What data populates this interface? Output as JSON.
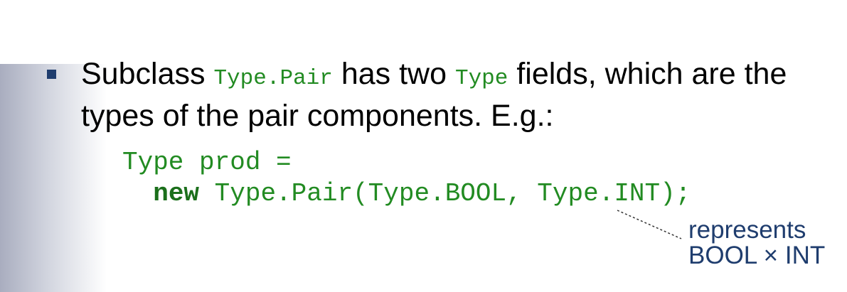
{
  "slide": {
    "bullet": {
      "part1": "Subclass ",
      "code1": "Type.Pair",
      "part2": " has two ",
      "code2": "Type",
      "part3": " fields, which are the types of the pair components. E.g.:"
    },
    "code": {
      "line1": "Type prod =",
      "keyword": "new",
      "line2_rest": " Type.Pair(Type.BOOL, Type.INT);"
    },
    "annotation": {
      "line1": "represents",
      "line2": "BOOL × INT"
    },
    "colors": {
      "code": "#228b22",
      "bullet": "#1f3d6e",
      "annotation": "#1f3d6e"
    }
  }
}
